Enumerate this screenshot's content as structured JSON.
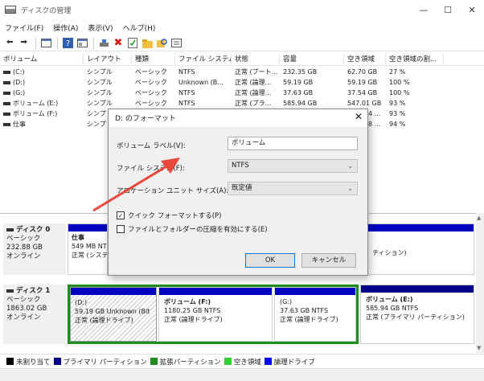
{
  "window": {
    "title": "ディスクの管理"
  },
  "menu": [
    "ファイル(F)",
    "操作(A)",
    "表示(V)",
    "ヘルプ(H)"
  ],
  "toolbar_icons": [
    "back-icon",
    "forward-icon",
    "console-tree-icon",
    "help-icon",
    "properties-icon",
    "connect-icon",
    "delete-icon",
    "check-icon",
    "folder-icon",
    "search-icon",
    "list-icon"
  ],
  "volume_list": {
    "headers": [
      "ボリューム",
      "レイアウト",
      "種類",
      "ファイル システム",
      "状態",
      "容量",
      "空き領域",
      "空き領域の割..."
    ],
    "rows": [
      [
        "(C:)",
        "シンプル",
        "ベーシック",
        "NTFS",
        "正常 (ブート...",
        "232.35 GB",
        "62.70 GB",
        "27 %"
      ],
      [
        "(D:)",
        "シンプル",
        "ベーシック",
        "Unknown (B...",
        "正常 (論理...",
        "59.19 GB",
        "59.19 GB",
        "100 %"
      ],
      [
        "(G:)",
        "シンプル",
        "ベーシック",
        "NTFS",
        "正常 (論理...",
        "37.63 GB",
        "37.54 GB",
        "100 %"
      ],
      [
        "ボリューム (E:)",
        "シンプル",
        "ベーシック",
        "NTFS",
        "正常 (プラ...",
        "585.94 GB",
        "547.01 GB",
        "93 %"
      ],
      [
        "ボリューム (F:)",
        "シンプ",
        "",
        "",
        "",
        "",
        "4 ...",
        "93 %"
      ],
      [
        "仕事",
        "シンプ",
        "",
        "",
        "",
        "",
        "8 ...",
        "94 %"
      ]
    ]
  },
  "disk0": {
    "name": "ディスク 0",
    "type": "ベーシック",
    "size": "232.88 GB",
    "status": "オンライン",
    "part1": {
      "title": "仕事",
      "line2": "549 MB NT",
      "line3": "正常 (システ"
    },
    "part_right": {
      "line3": "ティション)"
    }
  },
  "disk1": {
    "name": "ディスク 1",
    "type": "ベーシック",
    "size": "1863.02 GB",
    "status": "オンライン",
    "parts": [
      {
        "title": "(D:)",
        "line2": "59.19 GB Unknown (Bit",
        "line3": "正常 (論理ドライブ)"
      },
      {
        "title": "ボリューム  (F:)",
        "line2": "1180.25 GB NTFS",
        "line3": "正常 (論理ドライブ)"
      },
      {
        "title": "(G:)",
        "line2": "37.63 GB NTFS",
        "line3": "正常 (論理ドライブ)"
      },
      {
        "title": "ボリューム  (E:)",
        "line2": "585.94 GB NTFS",
        "line3": "正常 (プライマリ パーティション)"
      }
    ]
  },
  "legend": [
    {
      "label": "未割り当て",
      "color": "#000000"
    },
    {
      "label": "プライマリ パーティション",
      "color": "#00008b"
    },
    {
      "label": "拡張パーティション",
      "color": "#228b22"
    },
    {
      "label": "空き領域",
      "color": "#32cd32"
    },
    {
      "label": "論理ドライブ",
      "color": "#0000ff"
    }
  ],
  "dialog": {
    "title": "D: のフォーマット",
    "label_volume": "ボリューム ラベル(V):",
    "value_volume": "ボリューム",
    "label_fs": "ファイル システム(F):",
    "value_fs": "NTFS",
    "label_alloc": "アロケーション ユニット サイズ(A):",
    "value_alloc": "既定値",
    "quick_format": "クイック フォーマットする(P)",
    "compress": "ファイルとフォルダーの圧縮を有効にする(E)",
    "ok": "OK",
    "cancel": "キャンセル"
  },
  "colors": {
    "accent": "#0078d7",
    "arrow": "#e8473b",
    "partition_bar": "#0000c0",
    "selected_border": "#1e8e1e"
  }
}
